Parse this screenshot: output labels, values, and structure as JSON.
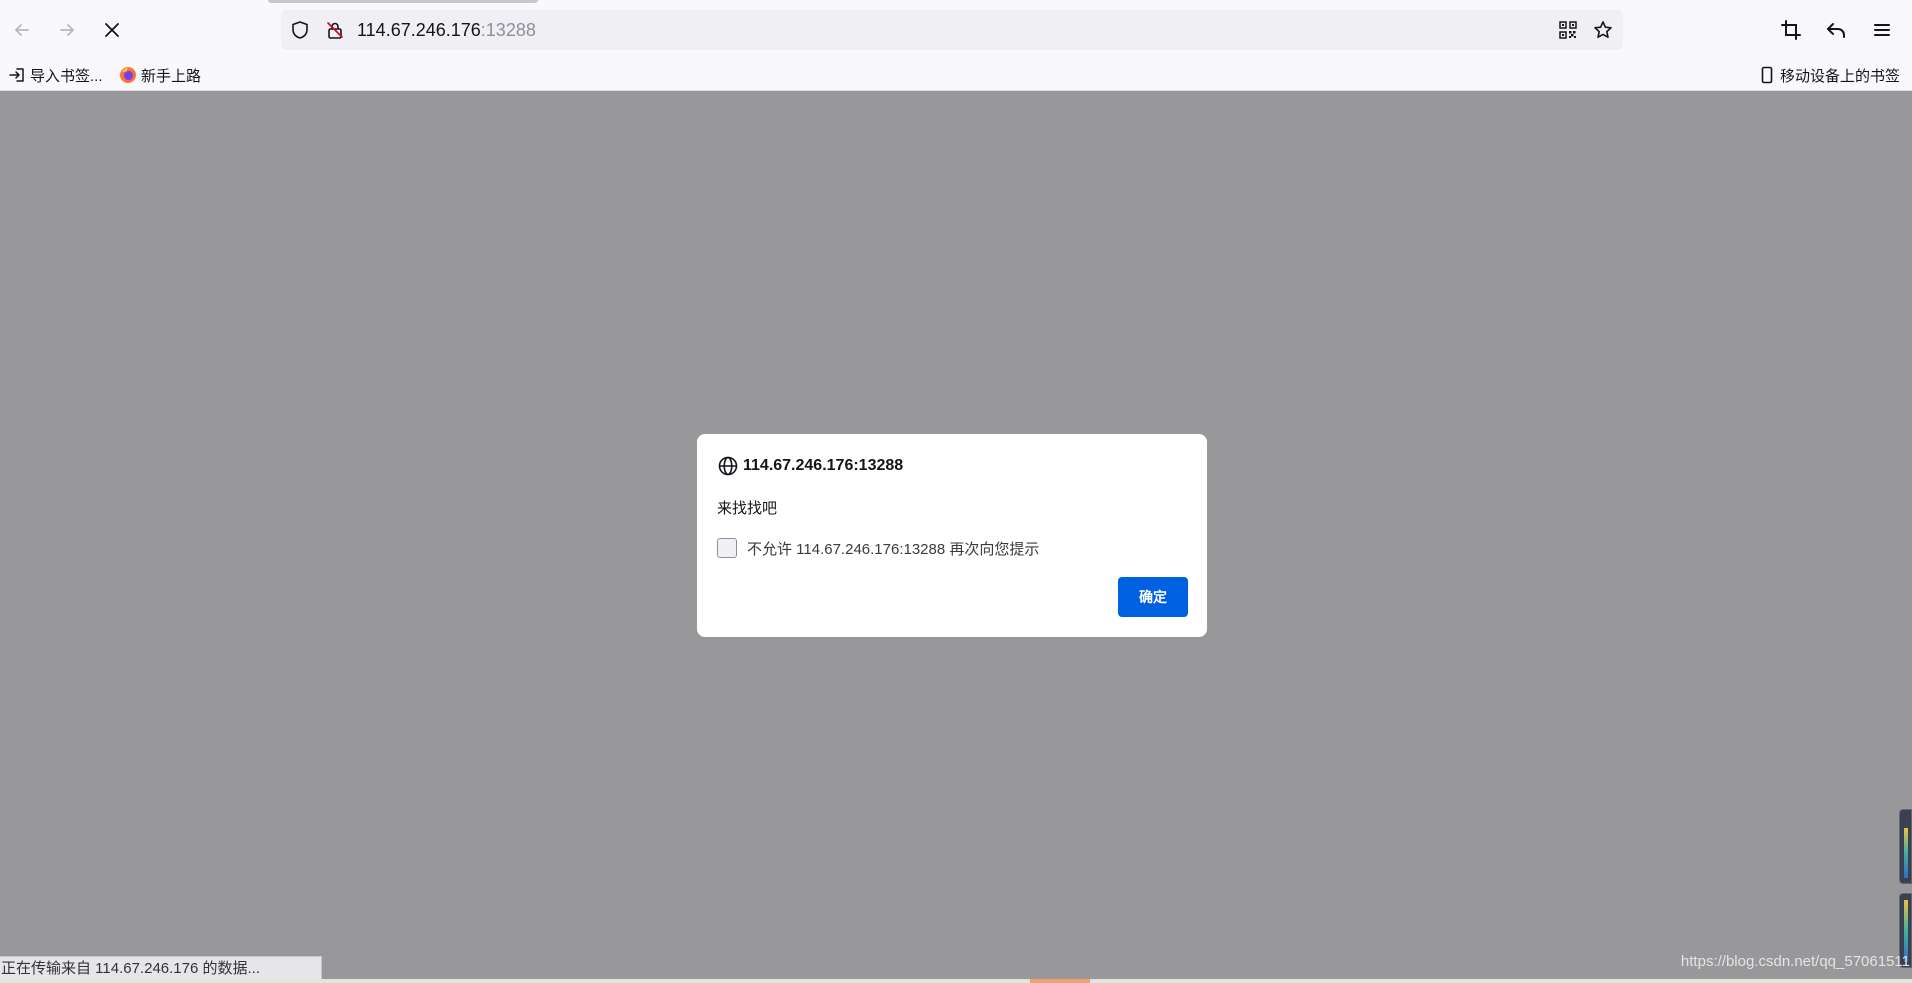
{
  "browser": {
    "url_host": "114.67.246.176",
    "url_port": ":13288",
    "nav": {
      "back_icon": "arrow-left-icon",
      "forward_icon": "arrow-right-icon",
      "stop_icon": "close-icon"
    },
    "toolbar_icons": [
      "shield-icon",
      "lock-warning-icon",
      "qr-code-icon",
      "star-icon",
      "crop-icon",
      "undo-icon",
      "menu-icon"
    ]
  },
  "bookmarks": {
    "import_label": "导入书签...",
    "getting_started_label": "新手上路",
    "mobile_label": "移动设备上的书签"
  },
  "dialog": {
    "title": "114.67.246.176:13288",
    "message": "来找找吧",
    "checkbox_label": "不允许 114.67.246.176:13288 再次向您提示",
    "checkbox_checked": false,
    "ok_label": "确定"
  },
  "status_bar": {
    "text": "正在传输来自 114.67.246.176 的数据..."
  },
  "watermark": "https://blog.csdn.net/qq_57061511",
  "colors": {
    "overlay": "#98989b",
    "accent": "#0061e0",
    "toolbar": "#f9f9fb",
    "urlbar": "#f0f0f4"
  }
}
